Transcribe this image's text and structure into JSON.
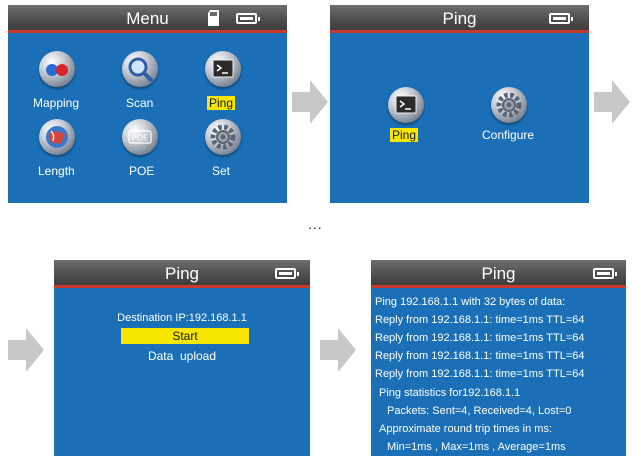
{
  "screens": {
    "menu": {
      "title": "Menu",
      "items": [
        {
          "label": "Mapping",
          "icon": "mapping-icon"
        },
        {
          "label": "Scan",
          "icon": "scan-icon"
        },
        {
          "label": "Ping",
          "icon": "ping-icon",
          "selected": true
        },
        {
          "label": "Length",
          "icon": "length-icon"
        },
        {
          "label": "POE",
          "icon": "poe-icon"
        },
        {
          "label": "Set",
          "icon": "settings-gear-icon"
        }
      ]
    },
    "ping_menu": {
      "title": "Ping",
      "items": [
        {
          "label": "Ping",
          "icon": "ping-icon",
          "selected": true
        },
        {
          "label": "Configure",
          "icon": "settings-gear-icon"
        }
      ]
    },
    "ping_start": {
      "title": "Ping",
      "destination": "Destination IP:192.168.1.1",
      "start_label": "Start",
      "upload_label": "Data  upload"
    },
    "ping_result": {
      "title": "Ping",
      "lines": [
        "Ping 192.168.1.1 with 32 bytes of data:",
        "Reply from 192.168.1.1: time=1ms TTL=64",
        "Reply from 192.168.1.1: time=1ms TTL=64",
        "Reply from 192.168.1.1: time=1ms TTL=64",
        "Reply from 192.168.1.1: time=1ms TTL=64",
        "Ping statistics for192.168.1.1",
        "Packets: Sent=4, Received=4, Lost=0",
        "Approximate round trip times in ms:",
        "Min=1ms , Max=1ms , Average=1ms"
      ]
    }
  },
  "ellipsis": "...",
  "colors": {
    "screen_bg": "#1a6fb6",
    "title_bar": "#4d4d4d",
    "title_underline": "#c9392e",
    "highlight": "#f7e700",
    "arrow": "#c8c8c8"
  }
}
